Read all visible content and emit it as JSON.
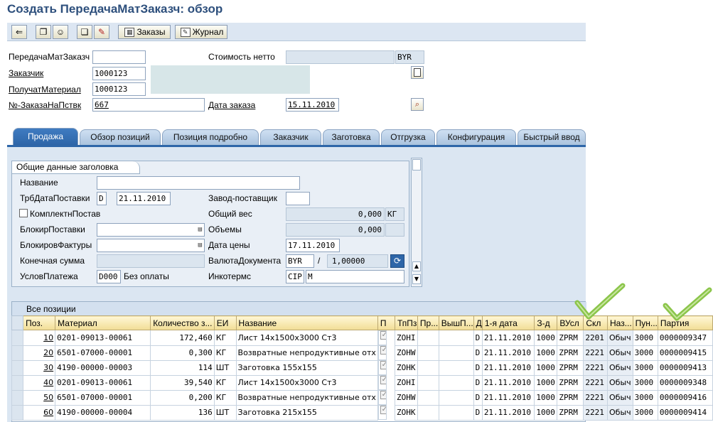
{
  "title": "Создать ПередачаМатЗаказч: обзор",
  "toolbar": {
    "orders_label": "Заказы",
    "journal_label": "Журнал"
  },
  "header": {
    "doc_label": "ПередачаМатЗаказч",
    "doc_value": "",
    "net_value_label": "Стоимость нетто",
    "net_value": "",
    "currency": "BYR",
    "customer_label": "Заказчик",
    "customer_value": "1000123",
    "recipient_label": "ПолучатМатериал",
    "recipient_value": "1000123",
    "po_label": "№-ЗаказаНаПствк",
    "po_value": "667",
    "order_date_label": "Дата заказа",
    "order_date_value": "15.11.2010"
  },
  "tabs": [
    "Продажа",
    "Обзор позиций",
    "Позиция подробно",
    "Заказчик",
    "Заготовка",
    "Отгрузка",
    "Конфигурация",
    "Быстрый ввод"
  ],
  "sales": {
    "group_title": "Общие данные заголовка",
    "name_label": "Название",
    "name_value": "",
    "req_date_label": "ТрбДатаПоставки",
    "req_date_type": "D",
    "req_date_value": "21.11.2010",
    "plant_label": "Завод-поставщик",
    "plant_value": "",
    "complete_label": "КомплектнПостав",
    "weight_label": "Общий вес",
    "weight_value": "0,000",
    "weight_unit": "КГ",
    "delivery_block_label": "БлокирПоставки",
    "volume_label": "Объемы",
    "volume_value": "0,000",
    "billing_block_label": "БлокировФактуры",
    "price_date_label": "Дата цены",
    "price_date_value": "17.11.2010",
    "final_amount_label": "Конечная сумма",
    "doc_currency_label": "ВалютаДокумента",
    "doc_currency_value": "BYR",
    "doc_rate_sep": "/",
    "doc_rate_value": "1,00000",
    "payment_terms_label": "УсловПлатежа",
    "payment_terms_value": "D000",
    "payment_terms_text": "Без оплаты",
    "incoterms_label": "Инкотермс",
    "incoterms_value": "CIP",
    "incoterms_place": "M"
  },
  "grid": {
    "title": "Все позиции",
    "columns": [
      "Поз.",
      "Материал",
      "Количество з...",
      "ЕИ",
      "Название",
      "П",
      "ТпПз",
      "Пр...",
      "ВышП...",
      "Д",
      "1-я дата",
      "З-д",
      "ВУсл",
      "Скл",
      "Наз...",
      "Пун...",
      "Партия"
    ],
    "rows": [
      {
        "pos": "10",
        "material": "0201-09013-00061",
        "qty": "172,460",
        "uom": "КГ",
        "name": "Лист 14х1500х3000 Ст3",
        "itemcat": "ZOHI",
        "d": "D",
        "date": "21.11.2010",
        "plant": "1000",
        "cond": "ZPRM",
        "sloc": "2201",
        "naz": "Обыч",
        "pun": "3000",
        "batch": "0000009347"
      },
      {
        "pos": "20",
        "material": "6501-07000-00001",
        "qty": "0,300",
        "uom": "КГ",
        "name": "Возвратные непродуктивные отх",
        "itemcat": "ZOHW",
        "d": "D",
        "date": "21.11.2010",
        "plant": "1000",
        "cond": "ZPRM",
        "sloc": "2221",
        "naz": "Обыч",
        "pun": "3000",
        "batch": "0000009415"
      },
      {
        "pos": "30",
        "material": "4190-00000-00003",
        "qty": "114",
        "uom": "ШТ",
        "name": "Заготовка 155х155",
        "itemcat": "ZOHK",
        "d": "D",
        "date": "21.11.2010",
        "plant": "1000",
        "cond": "ZPRM",
        "sloc": "2221",
        "naz": "Обыч",
        "pun": "3000",
        "batch": "0000009413"
      },
      {
        "pos": "40",
        "material": "0201-09013-00061",
        "qty": "39,540",
        "uom": "КГ",
        "name": "Лист 14х1500х3000 Ст3",
        "itemcat": "ZOHI",
        "d": "D",
        "date": "21.11.2010",
        "plant": "1000",
        "cond": "ZPRM",
        "sloc": "2221",
        "naz": "Обыч",
        "pun": "3000",
        "batch": "0000009348"
      },
      {
        "pos": "50",
        "material": "6501-07000-00001",
        "qty": "0,200",
        "uom": "КГ",
        "name": "Возвратные непродуктивные отх",
        "itemcat": "ZOHW",
        "d": "D",
        "date": "21.11.2010",
        "plant": "1000",
        "cond": "ZPRM",
        "sloc": "2221",
        "naz": "Обыч",
        "pun": "3000",
        "batch": "0000009416"
      },
      {
        "pos": "60",
        "material": "4190-00000-00004",
        "qty": "136",
        "uom": "ШТ",
        "name": "Заготовка 215х155",
        "itemcat": "ZOHK",
        "d": "D",
        "date": "21.11.2010",
        "plant": "1000",
        "cond": "ZPRM",
        "sloc": "2221",
        "naz": "Обыч",
        "pun": "3000",
        "batch": "0000009414"
      }
    ]
  },
  "icons": [
    "back-icon",
    "copy-icon",
    "person-icon",
    "documents-icon",
    "edit-icon",
    "orders-icon",
    "journal-icon",
    "header-detail-icon",
    "search-detail-icon",
    "refresh-icon",
    "checkmark-icon"
  ],
  "colors": {
    "title": "#2d4f7c",
    "active_tab": "#2e66a8",
    "check": "#7fc241"
  }
}
